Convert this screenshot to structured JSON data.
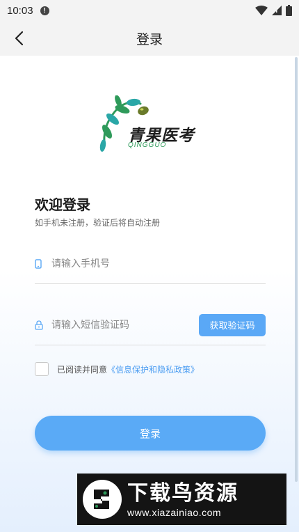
{
  "status_bar": {
    "time": "10:03",
    "alert_glyph": "!",
    "icons": [
      "wifi-icon",
      "signal-icon",
      "battery-icon"
    ]
  },
  "header": {
    "title": "登录",
    "back_icon": "chevron-left-icon"
  },
  "logo": {
    "brand_cn": "青果医考",
    "brand_en": "QINGGUO",
    "colors": {
      "green": "#2e9a5a",
      "teal": "#2aa7a7",
      "dark": "#1f1f1f"
    }
  },
  "welcome": {
    "title": "欢迎登录",
    "subtitle": "如手机未注册，验证后将自动注册"
  },
  "form": {
    "phone": {
      "placeholder": "请输入手机号",
      "value": "",
      "icon": "phone-icon"
    },
    "code": {
      "placeholder": "请输入短信验证码",
      "value": "",
      "icon": "lock-icon"
    },
    "get_code_label": "获取验证码"
  },
  "agreement": {
    "checked": false,
    "text": "已阅读并同意",
    "link": "《信息保护和隐私政策》"
  },
  "login_button": "登录",
  "watermark": {
    "title": "下载鸟资源",
    "url": "www.xiazainiao.com"
  },
  "colors": {
    "accent": "#5aaaf6",
    "link": "#4a9cf1"
  }
}
